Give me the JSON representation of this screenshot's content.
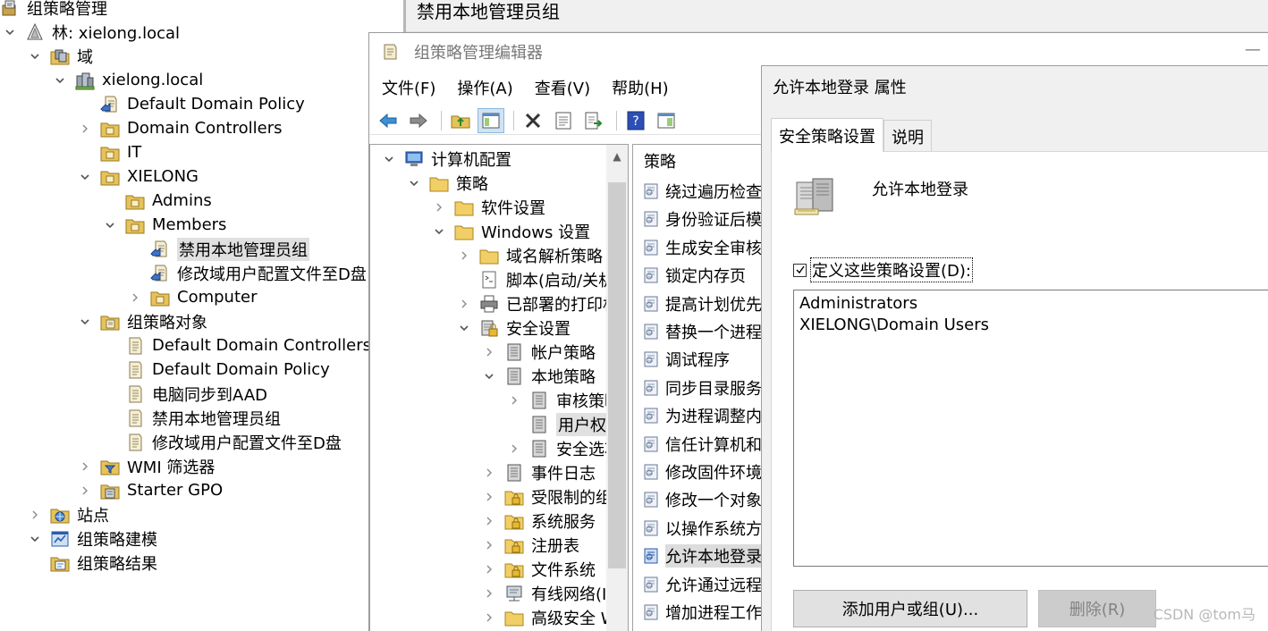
{
  "gpmc": {
    "title": "组策略管理",
    "tree": [
      {
        "label": "林: xielong.local",
        "icon": "forest-icon",
        "expander": "expanded"
      },
      {
        "label": "域",
        "icon": "domains-folder-icon",
        "expander": "expanded"
      },
      {
        "label": "xielong.local",
        "icon": "domain-icon",
        "expander": "expanded"
      },
      {
        "label": "Default Domain Policy",
        "icon": "gpo-link-icon",
        "expander": "none"
      },
      {
        "label": "Domain Controllers",
        "icon": "ou-folder-icon",
        "expander": "collapsed"
      },
      {
        "label": "IT",
        "icon": "ou-folder-icon",
        "expander": "none"
      },
      {
        "label": "XIELONG",
        "icon": "ou-folder-icon",
        "expander": "expanded"
      },
      {
        "label": "Admins",
        "icon": "ou-folder-icon",
        "expander": "none"
      },
      {
        "label": "Members",
        "icon": "ou-folder-icon",
        "expander": "expanded"
      },
      {
        "label": "禁用本地管理员组",
        "icon": "gpo-link-icon",
        "expander": "none",
        "selected": true
      },
      {
        "label": "修改域用户配置文件至D盘",
        "icon": "gpo-link-icon",
        "expander": "none"
      },
      {
        "label": "Computer",
        "icon": "ou-folder-icon",
        "expander": "collapsed"
      },
      {
        "label": "组策略对象",
        "icon": "gpo-container-icon",
        "expander": "expanded"
      },
      {
        "label": "Default Domain Controllers P",
        "icon": "gpo-scroll-icon",
        "expander": "none"
      },
      {
        "label": "Default Domain Policy",
        "icon": "gpo-scroll-icon",
        "expander": "none"
      },
      {
        "label": "电脑同步到AAD",
        "icon": "gpo-scroll-icon",
        "expander": "none"
      },
      {
        "label": "禁用本地管理员组",
        "icon": "gpo-scroll-icon",
        "expander": "none"
      },
      {
        "label": "修改域用户配置文件至D盘",
        "icon": "gpo-scroll-icon",
        "expander": "none"
      },
      {
        "label": "WMI 筛选器",
        "icon": "wmi-filter-icon",
        "expander": "collapsed"
      },
      {
        "label": "Starter GPO",
        "icon": "starter-gpo-icon",
        "expander": "collapsed"
      },
      {
        "label": "站点",
        "icon": "sites-icon",
        "expander": "collapsed"
      },
      {
        "label": "组策略建模",
        "icon": "gp-modeling-icon",
        "expander": "expanded"
      },
      {
        "label": "组策略结果",
        "icon": "gp-results-icon",
        "expander": "none"
      }
    ]
  },
  "right_panel": {
    "title": "禁用本地管理员组"
  },
  "editor": {
    "title": "组策略管理编辑器",
    "menu": [
      "文件(F)",
      "操作(A)",
      "查看(V)",
      "帮助(H)"
    ],
    "tree": [
      {
        "label": "计算机配置",
        "icon": "computer-config-icon",
        "expander": "expanded"
      },
      {
        "label": "策略",
        "icon": "folder-icon",
        "expander": "expanded"
      },
      {
        "label": "软件设置",
        "icon": "folder-icon",
        "expander": "collapsed"
      },
      {
        "label": "Windows 设置",
        "icon": "folder-icon",
        "expander": "expanded"
      },
      {
        "label": "域名解析策略",
        "icon": "folder-icon",
        "expander": "collapsed"
      },
      {
        "label": "脚本(启动/关机",
        "icon": "script-icon",
        "expander": "none"
      },
      {
        "label": "已部署的打印机",
        "icon": "printer-icon",
        "expander": "collapsed"
      },
      {
        "label": "安全设置",
        "icon": "security-settings-icon",
        "expander": "expanded"
      },
      {
        "label": "帐户策略",
        "icon": "policy-book-icon",
        "expander": "collapsed"
      },
      {
        "label": "本地策略",
        "icon": "policy-book-icon",
        "expander": "expanded"
      },
      {
        "label": "审核策略",
        "icon": "policy-book-icon",
        "expander": "collapsed"
      },
      {
        "label": "用户权限分配",
        "icon": "policy-book-icon",
        "expander": "none",
        "selected": true
      },
      {
        "label": "安全选项",
        "icon": "policy-book-icon",
        "expander": "collapsed"
      },
      {
        "label": "事件日志",
        "icon": "policy-book-icon",
        "expander": "collapsed"
      },
      {
        "label": "受限制的组",
        "icon": "lock-folder-icon",
        "expander": "collapsed"
      },
      {
        "label": "系统服务",
        "icon": "lock-folder-icon",
        "expander": "collapsed"
      },
      {
        "label": "注册表",
        "icon": "lock-folder-icon",
        "expander": "collapsed"
      },
      {
        "label": "文件系统",
        "icon": "lock-folder-icon",
        "expander": "collapsed"
      },
      {
        "label": "有线网络(IEEE",
        "icon": "network-icon",
        "expander": "collapsed"
      },
      {
        "label": "高级安全 Windows",
        "icon": "folder-icon",
        "expander": "collapsed"
      }
    ],
    "list_header": "策略",
    "list": [
      "绕过遍历检查",
      "身份验证后模拟客户端",
      "生成安全审核",
      "锁定内存页",
      "提高计划优先级",
      "替换一个进程级令牌",
      "调试程序",
      "同步目录服务数据",
      "为进程调整内存配额",
      "信任计算机和用户帐户",
      "修改固件环境值",
      "修改一个对象标签",
      "以操作系统方式执行",
      "允许本地登录",
      "允许通过远程桌面服务登录",
      "增加进程工作集"
    ],
    "list_selected_index": 13
  },
  "dialog": {
    "title": "允许本地登录 属性",
    "tabs": [
      "安全策略设置",
      "说明"
    ],
    "policy_name": "允许本地登录",
    "checkbox_label": "定义这些策略设置(D):",
    "checkbox_checked": true,
    "entries": [
      "Administrators",
      "XIELONG\\Domain Users"
    ],
    "add_button": "添加用户或组(U)...",
    "remove_button": "删除(R)"
  },
  "watermark": "CSDN @tom马"
}
